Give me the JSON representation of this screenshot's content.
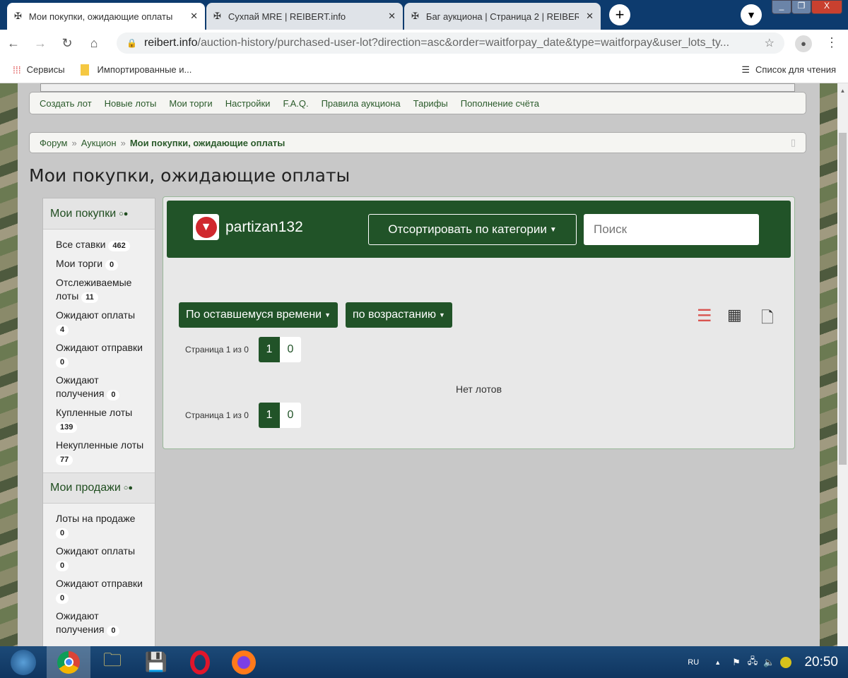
{
  "browser": {
    "tabs": [
      {
        "title": "Мои покупки, ожидающие оплаты",
        "active": true
      },
      {
        "title": "Сухпай MRE | REIBERT.info",
        "active": false
      },
      {
        "title": "Баг аукциона | Страница 2 | REIBERT",
        "active": false
      }
    ],
    "url_host": "reibert.info",
    "url_path": "/auction-history/purchased-user-lot?direction=asc&order=waitforpay_date&type=waitforpay&user_lots_ty...",
    "bookmarks": [
      "Сервисы",
      "Импортированные и..."
    ],
    "reading_list": "Список для чтения"
  },
  "nav": [
    "Создать лот",
    "Новые лоты",
    "Мои торги",
    "Настройки",
    "F.A.Q.",
    "Правила аукциона",
    "Тарифы",
    "Пополнение счёта"
  ],
  "breadcrumb": {
    "items": [
      "Форум",
      "Аукцион"
    ],
    "current": "Мои покупки, ожидающие оплаты",
    "sep": "»"
  },
  "page_title": "Мои покупки, ожидающие оплаты",
  "sidebar": {
    "purchases_title": "Мои покупки",
    "purchases": [
      {
        "label": "Все ставки",
        "count": "462"
      },
      {
        "label": "Мои торги",
        "count": "0"
      },
      {
        "label": "Отслеживаемые лоты",
        "count": "11"
      },
      {
        "label": "Ожидают оплаты",
        "count": "4"
      },
      {
        "label": "Ожидают отправки",
        "count": "0"
      },
      {
        "label": "Ожидают получения",
        "count": "0"
      },
      {
        "label": "Купленные лоты",
        "count": "139"
      },
      {
        "label": "Некупленные лоты",
        "count": "77"
      }
    ],
    "sales_title": "Мои продажи",
    "sales": [
      {
        "label": "Лоты на продаже",
        "count": "0"
      },
      {
        "label": "Ожидают оплаты",
        "count": "0"
      },
      {
        "label": "Ожидают отправки",
        "count": "0"
      },
      {
        "label": "Ожидают получения",
        "count": "0"
      }
    ]
  },
  "main": {
    "username": "partizan132",
    "category_button": "Отсортировать по категории",
    "search_placeholder": "Поиск",
    "sort_button": "По оставшемуся времени",
    "order_button": "по возрастанию",
    "page_label": "Страница 1 из 0",
    "page_current": "1",
    "page_other": "0",
    "empty": "Нет лотов",
    "accent": "#215328"
  },
  "taskbar": {
    "lang": "RU",
    "time": "20:50"
  }
}
